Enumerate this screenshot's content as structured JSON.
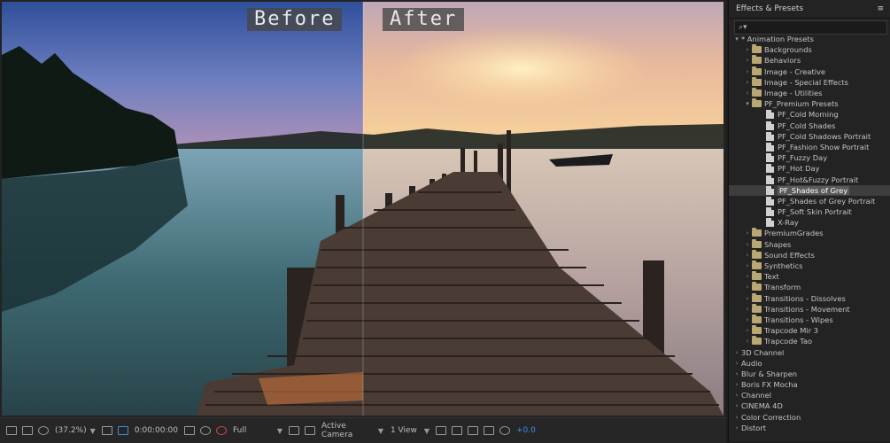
{
  "viewer": {
    "before_label": "Before",
    "after_label": "After",
    "toolbar": {
      "magnification": "(37.2%)",
      "timecode": "0:00:00:00",
      "resolution": "Full",
      "camera": "Active Camera",
      "views": "1 View",
      "exposure": "+0.0"
    }
  },
  "panel": {
    "title": "Effects & Presets",
    "menu_icon": "≡",
    "search_placeholder": "",
    "tree": [
      {
        "label": "* Animation Presets",
        "level": 0,
        "type": "folder-open-noicon"
      },
      {
        "label": "Backgrounds",
        "level": 1,
        "type": "folder"
      },
      {
        "label": "Behaviors",
        "level": 1,
        "type": "folder"
      },
      {
        "label": "Image - Creative",
        "level": 1,
        "type": "folder"
      },
      {
        "label": "Image - Special Effects",
        "level": 1,
        "type": "folder"
      },
      {
        "label": "Image - Utilities",
        "level": 1,
        "type": "folder"
      },
      {
        "label": "PF_Premium Presets",
        "level": 1,
        "type": "folder-open"
      },
      {
        "label": "PF_Cold Morning",
        "level": 2,
        "type": "file"
      },
      {
        "label": "PF_Cold Shades",
        "level": 2,
        "type": "file"
      },
      {
        "label": "PF_Cold Shadows Portrait",
        "level": 2,
        "type": "file"
      },
      {
        "label": "PF_Fashion Show Portrait",
        "level": 2,
        "type": "file"
      },
      {
        "label": "PF_Fuzzy Day",
        "level": 2,
        "type": "file"
      },
      {
        "label": "PF_Hot Day",
        "level": 2,
        "type": "file"
      },
      {
        "label": "PF_Hot&Fuzzy Portrait",
        "level": 2,
        "type": "file"
      },
      {
        "label": "PF_Shades of Grey",
        "level": 2,
        "type": "file",
        "selected": true
      },
      {
        "label": "PF_Shades of Grey Portrait",
        "level": 2,
        "type": "file"
      },
      {
        "label": "PF_Soft Skin Portrait",
        "level": 2,
        "type": "file"
      },
      {
        "label": "X-Ray",
        "level": 2,
        "type": "file"
      },
      {
        "label": "PremiumGrades",
        "level": 1,
        "type": "folder"
      },
      {
        "label": "Shapes",
        "level": 1,
        "type": "folder"
      },
      {
        "label": "Sound Effects",
        "level": 1,
        "type": "folder"
      },
      {
        "label": "Synthetics",
        "level": 1,
        "type": "folder"
      },
      {
        "label": "Text",
        "level": 1,
        "type": "folder"
      },
      {
        "label": "Transform",
        "level": 1,
        "type": "folder"
      },
      {
        "label": "Transitions - Dissolves",
        "level": 1,
        "type": "folder"
      },
      {
        "label": "Transitions - Movement",
        "level": 1,
        "type": "folder"
      },
      {
        "label": "Transitions - Wipes",
        "level": 1,
        "type": "folder"
      },
      {
        "label": "Trapcode Mir 3",
        "level": 1,
        "type": "folder"
      },
      {
        "label": "Trapcode Tao",
        "level": 1,
        "type": "folder"
      },
      {
        "label": "3D Channel",
        "level": 0,
        "type": "category"
      },
      {
        "label": "Audio",
        "level": 0,
        "type": "category"
      },
      {
        "label": "Blur & Sharpen",
        "level": 0,
        "type": "category"
      },
      {
        "label": "Boris FX Mocha",
        "level": 0,
        "type": "category"
      },
      {
        "label": "Channel",
        "level": 0,
        "type": "category"
      },
      {
        "label": "CINEMA 4D",
        "level": 0,
        "type": "category"
      },
      {
        "label": "Color Correction",
        "level": 0,
        "type": "category"
      },
      {
        "label": "Distort",
        "level": 0,
        "type": "category"
      }
    ]
  },
  "colors": {
    "accent": "#3a8ee6",
    "folder": "#b9a774",
    "selection": "#5a5a5a"
  }
}
